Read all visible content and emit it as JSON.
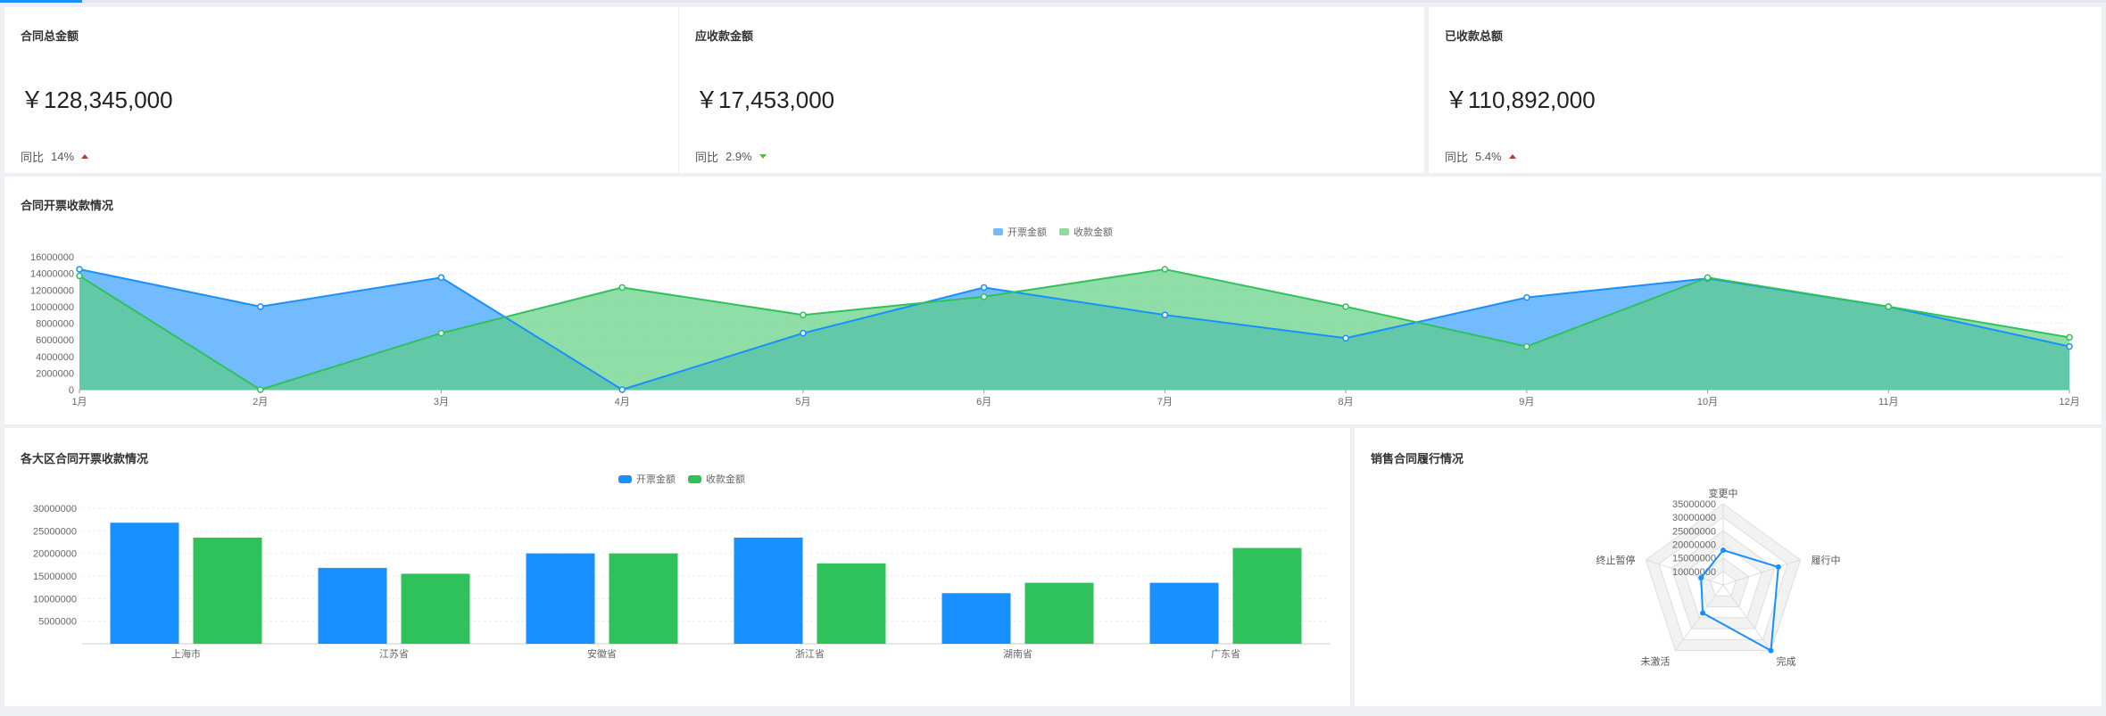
{
  "stats": [
    {
      "title": "合同总金额",
      "value": "￥128,345,000",
      "compare_label": "同比",
      "compare_value": "14%",
      "trend": "up"
    },
    {
      "title": "应收款金额",
      "value": "￥17,453,000",
      "compare_label": "同比",
      "compare_value": "2.9%",
      "trend": "down"
    },
    {
      "title": "已收款总额",
      "value": "￥110,892,000",
      "compare_label": "同比",
      "compare_value": "5.4%",
      "trend": "up"
    }
  ],
  "area_card": {
    "title": "合同开票收款情况"
  },
  "bar_card": {
    "title": "各大区合同开票收款情况"
  },
  "radar_card": {
    "title": "销售合同履行情况"
  },
  "colors": {
    "blue": "#1890ff",
    "blue_fill": "#73bbff",
    "green": "#2fc25b",
    "green_fill": "#5ccf7e",
    "up": "#e0262b",
    "down": "#52c41a"
  },
  "chart_data": [
    {
      "type": "area",
      "categories": [
        "1月",
        "2月",
        "3月",
        "4月",
        "5月",
        "6月",
        "7月",
        "8月",
        "9月",
        "10月",
        "11月",
        "12月"
      ],
      "series": [
        {
          "name": "开票金额",
          "values": [
            14500000,
            10000000,
            13500000,
            0,
            6800000,
            12300000,
            9000000,
            6200000,
            11100000,
            13400000,
            10000000,
            5200000
          ]
        },
        {
          "name": "收款金额",
          "values": [
            13700000,
            0,
            6800000,
            12300000,
            9000000,
            11200000,
            14500000,
            10000000,
            5200000,
            13500000,
            10000000,
            6300000
          ]
        }
      ],
      "ylim": [
        0,
        16000000
      ],
      "yticks": [
        "16000000",
        "14000000",
        "12000000",
        "10000000",
        "8000000",
        "6000000",
        "4000000",
        "2000000",
        "0"
      ],
      "legend": "top-center",
      "grid": true
    },
    {
      "type": "bar",
      "categories": [
        "上海市",
        "江苏省",
        "安徽省",
        "浙江省",
        "湖南省",
        "广东省"
      ],
      "series": [
        {
          "name": "开票金额",
          "values": [
            26800000,
            16800000,
            20000000,
            23500000,
            11200000,
            13500000
          ]
        },
        {
          "name": "收款金额",
          "values": [
            23500000,
            15500000,
            20000000,
            17800000,
            13500000,
            21200000
          ]
        }
      ],
      "ylim": [
        0,
        30000000
      ],
      "yticks": [
        "30000000",
        "25000000",
        "20000000",
        "15000000",
        "10000000",
        "5000000"
      ],
      "legend": "top-center",
      "grid": true
    },
    {
      "type": "radar",
      "indicators": [
        "变更中",
        "履行中",
        "完成",
        "未激活",
        "终止暂停"
      ],
      "series": [
        {
          "values": [
            15000000,
            25000000,
            35000000,
            15000000,
            10000000
          ]
        }
      ],
      "max": 35000000,
      "rings": [
        "35000000",
        "30000000",
        "25000000",
        "20000000",
        "15000000",
        "10000000"
      ]
    }
  ]
}
